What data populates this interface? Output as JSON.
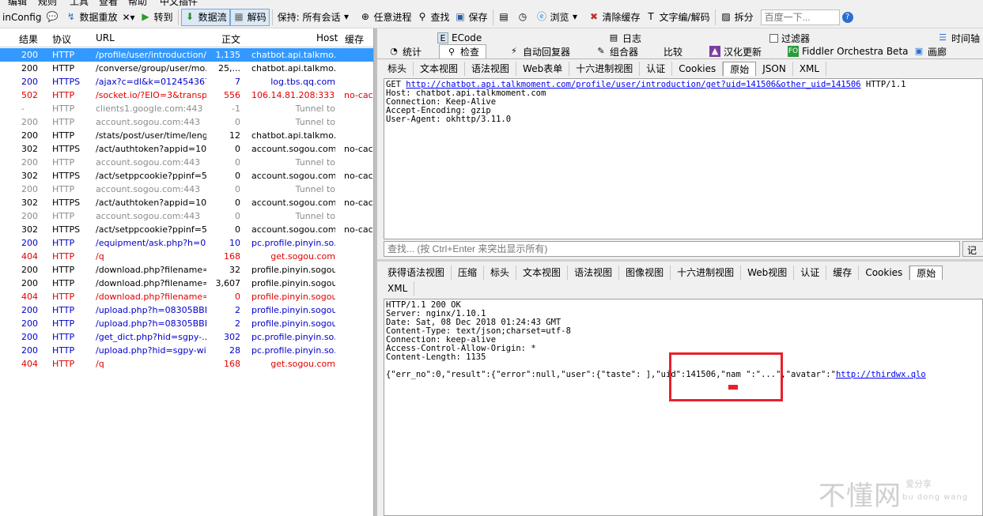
{
  "menu": [
    "编辑",
    "规则",
    "工具",
    "查看",
    "帮助",
    "中文插件"
  ],
  "toolbar": {
    "winconfig": "inConfig",
    "replay": "数据重放",
    "remove": "✕▾",
    "go": "转到",
    "stream": "数据流",
    "decode": "解码",
    "keep": "保持: 所有会话",
    "any_process": "任意进程",
    "find": "查找",
    "save": "保存",
    "browse": "浏览",
    "clear_cache": "清除缓存",
    "text_encode": "文字编/解码",
    "tearoff": "拆分",
    "search_placeholder": "百度一下..."
  },
  "sessions": {
    "headers": {
      "result": "结果",
      "protocol": "协议",
      "url": "URL",
      "body": "正文",
      "host": "Host",
      "cache": "缓存"
    },
    "rows": [
      {
        "result": "200",
        "protocol": "HTTP",
        "url": "/profile/user/introduction/...",
        "body": "1,135",
        "host": "chatbot.api.talkmo...",
        "cache": "",
        "style": "selected"
      },
      {
        "result": "200",
        "protocol": "HTTP",
        "url": "/converse/group/user/mo...",
        "body": "25,...",
        "host": "chatbot.api.talkmo...",
        "cache": "",
        "style": "black"
      },
      {
        "result": "200",
        "protocol": "HTTPS",
        "url": "/ajax?c=dl&k=012454367...",
        "body": "7",
        "host": "log.tbs.qq.com",
        "cache": "",
        "style": "blue"
      },
      {
        "result": "502",
        "protocol": "HTTP",
        "url": "/socket.io/?EIO=3&transp...",
        "body": "556",
        "host": "106.14.81.208:3333",
        "cache": "no-cac..",
        "style": "red"
      },
      {
        "result": "-",
        "protocol": "HTTP",
        "url": "clients1.google.com:443",
        "body": "-1",
        "host": "Tunnel to",
        "cache": "",
        "style": "gray"
      },
      {
        "result": "200",
        "protocol": "HTTP",
        "url": "account.sogou.com:443",
        "body": "0",
        "host": "Tunnel to",
        "cache": "",
        "style": "gray"
      },
      {
        "result": "200",
        "protocol": "HTTP",
        "url": "/stats/post/user/time/length",
        "body": "12",
        "host": "chatbot.api.talkmo...",
        "cache": "",
        "style": "black"
      },
      {
        "result": "302",
        "protocol": "HTTPS",
        "url": "/act/authtoken?appid=10...",
        "body": "0",
        "host": "account.sogou.com",
        "cache": "no-cac..",
        "style": "black"
      },
      {
        "result": "200",
        "protocol": "HTTP",
        "url": "account.sogou.com:443",
        "body": "0",
        "host": "Tunnel to",
        "cache": "",
        "style": "gray"
      },
      {
        "result": "302",
        "protocol": "HTTPS",
        "url": "/act/setppcookie?ppinf=5...",
        "body": "0",
        "host": "account.sogou.com",
        "cache": "no-cac..",
        "style": "black"
      },
      {
        "result": "200",
        "protocol": "HTTP",
        "url": "account.sogou.com:443",
        "body": "0",
        "host": "Tunnel to",
        "cache": "",
        "style": "gray"
      },
      {
        "result": "302",
        "protocol": "HTTPS",
        "url": "/act/authtoken?appid=10...",
        "body": "0",
        "host": "account.sogou.com",
        "cache": "no-cac..",
        "style": "black"
      },
      {
        "result": "200",
        "protocol": "HTTP",
        "url": "account.sogou.com:443",
        "body": "0",
        "host": "Tunnel to",
        "cache": "",
        "style": "gray"
      },
      {
        "result": "302",
        "protocol": "HTTPS",
        "url": "/act/setppcookie?ppinf=5...",
        "body": "0",
        "host": "account.sogou.com",
        "cache": "no-cac..",
        "style": "black"
      },
      {
        "result": "200",
        "protocol": "HTTP",
        "url": "/equipment/ask.php?h=0...",
        "body": "10",
        "host": "pc.profile.pinyin.so...",
        "cache": "",
        "style": "blue"
      },
      {
        "result": "404",
        "protocol": "HTTP",
        "url": "/q",
        "body": "168",
        "host": "get.sogou.com",
        "cache": "",
        "style": "red"
      },
      {
        "result": "200",
        "protocol": "HTTP",
        "url": "/download.php?filename=...",
        "body": "32",
        "host": "profile.pinyin.sogou...",
        "cache": "",
        "style": "black"
      },
      {
        "result": "200",
        "protocol": "HTTP",
        "url": "/download.php?filename=...",
        "body": "3,607",
        "host": "profile.pinyin.sogou...",
        "cache": "",
        "style": "black"
      },
      {
        "result": "404",
        "protocol": "HTTP",
        "url": "/download.php?filename=...",
        "body": "0",
        "host": "profile.pinyin.sogou...",
        "cache": "",
        "style": "red"
      },
      {
        "result": "200",
        "protocol": "HTTP",
        "url": "/upload.php?h=08305BBB...",
        "body": "2",
        "host": "profile.pinyin.sogou...",
        "cache": "",
        "style": "blue"
      },
      {
        "result": "200",
        "protocol": "HTTP",
        "url": "/upload.php?h=08305BBB...",
        "body": "2",
        "host": "profile.pinyin.sogou...",
        "cache": "",
        "style": "blue"
      },
      {
        "result": "200",
        "protocol": "HTTP",
        "url": "/get_dict.php?hid=sgpy-...",
        "body": "302",
        "host": "pc.profile.pinyin.so...",
        "cache": "",
        "style": "blue"
      },
      {
        "result": "200",
        "protocol": "HTTP",
        "url": "/upload.php?hid=sgpy-wi...",
        "body": "28",
        "host": "pc.profile.pinyin.so...",
        "cache": "",
        "style": "blue"
      },
      {
        "result": "404",
        "protocol": "HTTP",
        "url": "/q",
        "body": "168",
        "host": "get.sogou.com",
        "cache": "",
        "style": "red"
      }
    ]
  },
  "top_tabs_row1": {
    "ecode": "ECode",
    "log": "日志",
    "filters": "过滤器",
    "timeline": "时间轴"
  },
  "top_tabs_row2": {
    "stats": "统计",
    "inspectors": "检查",
    "autoresponder": "自动回复器",
    "composer": "组合器",
    "compare": "比较",
    "hanhua": "汉化更新",
    "orchestra": "Fiddler Orchestra Beta",
    "gallery": "画廊"
  },
  "request_tabs": [
    "标头",
    "文本视图",
    "语法视图",
    "Web表单",
    "十六进制视图",
    "认证",
    "Cookies",
    "原始",
    "JSON",
    "XML"
  ],
  "request_active_tab": "原始",
  "request": {
    "method": "GET",
    "url": "http://chatbot.api.talkmoment.com/profile/user/introduction/get?uid=141506&other_uid=141506",
    "version": "HTTP/1.1",
    "headers": "Host: chatbot.api.talkmoment.com\nConnection: Keep-Alive\nAccept-Encoding: gzip\nUser-Agent: okhttp/3.11.0"
  },
  "find": {
    "placeholder": "查找... (按 Ctrl+Enter 来突出显示所有)",
    "button": "记"
  },
  "response_tabs": [
    "获得语法视图",
    "压缩",
    "标头",
    "文本视图",
    "语法视图",
    "图像视图",
    "十六进制视图",
    "Web视图",
    "认证",
    "缓存",
    "Cookies",
    "原始"
  ],
  "response_tabs_row2": [
    "XML"
  ],
  "response_active_tab": "原始",
  "response": {
    "headers": "HTTP/1.1 200 OK\nServer: nginx/1.10.1\nDate: Sat, 08 Dec 2018 01:24:43 GMT\nContent-Type: text/json;charset=utf-8\nConnection: keep-alive\nAccess-Control-Allow-Origin: *\nContent-Length: 1135",
    "body_prefix": "{\"err_no\":0,\"result\":{\"error\":null,\"user\":{\"taste\": ],\"uid\":141506,\"nam \":\"...\",\"avatar\":\"",
    "body_link": "http://thirdwx.qlo"
  },
  "highlight_color": "#e8202a",
  "watermark": {
    "main": "不懂网",
    "sub1": "爱分享",
    "sub2": "bu dong wang"
  }
}
